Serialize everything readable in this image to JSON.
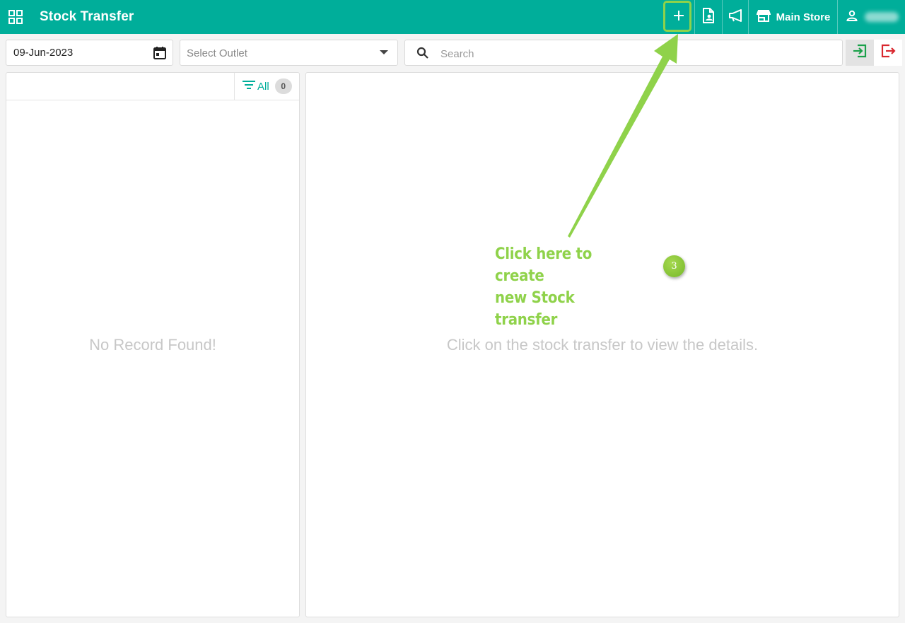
{
  "header": {
    "title": "Stock Transfer",
    "store_label": "Main Store"
  },
  "filters": {
    "date_value": "09-Jun-2023",
    "outlet_placeholder": "Select Outlet",
    "search_placeholder": "Search"
  },
  "list_panel": {
    "filter_label": "All",
    "count": "0",
    "empty_text": "No Record Found!"
  },
  "detail_panel": {
    "empty_text": "Click on the stock transfer to view the details."
  },
  "annotation": {
    "line1": "Click here to create",
    "line2": "new Stock transfer",
    "step": "3"
  },
  "colors": {
    "brand": "#00ae9a",
    "annotation": "#8fd24a",
    "import": "#1aa14a",
    "export": "#d9272e"
  }
}
